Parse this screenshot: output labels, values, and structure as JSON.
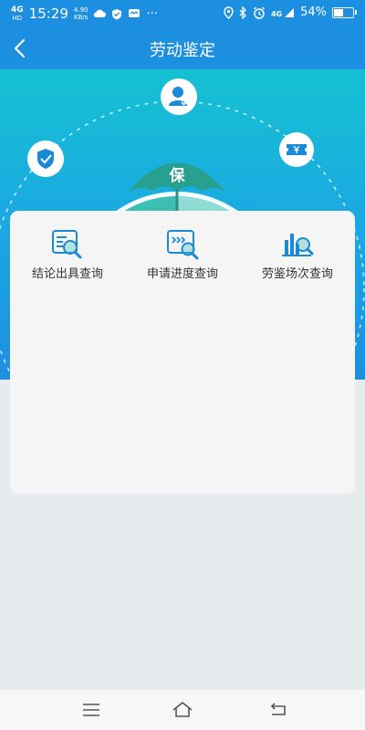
{
  "status_bar": {
    "network_type": "4G",
    "network_sub": "HD",
    "time": "15:29",
    "speed_value": "4.90",
    "speed_unit": "KB/s",
    "more": "···",
    "signal_label": "4G",
    "battery_percent_text": "54%",
    "battery_level": 0.54,
    "icons_left": [
      "cloud-icon",
      "shield-check-icon",
      "message-icon"
    ],
    "icons_right": [
      "location-icon",
      "bluetooth-icon",
      "alarm-icon",
      "signal-icon",
      "battery-icon"
    ]
  },
  "nav": {
    "title": "劳动鉴定",
    "back_icon": "chevron-left-icon"
  },
  "banner": {
    "umbrella_char": "保",
    "orbit_icons": [
      "shield-icon",
      "user-check-icon",
      "ticket-yen-icon"
    ]
  },
  "services": [
    {
      "label": "结论出具查询",
      "icon": "document-search-icon"
    },
    {
      "label": "申请进度查询",
      "icon": "progress-search-icon"
    },
    {
      "label": "劳鉴场次查询",
      "icon": "chart-search-icon"
    }
  ],
  "colors": {
    "primary": "#1d8fe0",
    "accent_teal": "#38bfb0",
    "icon_blue": "#1b8ad6",
    "page_bg": "#e6ebed",
    "card_bg": "#f5f5f5"
  },
  "bottom_nav": {
    "icons": [
      "menu-icon",
      "home-icon",
      "back-icon"
    ]
  }
}
